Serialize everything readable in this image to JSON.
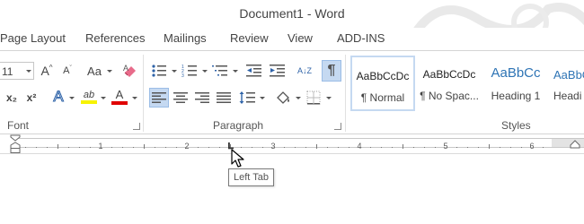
{
  "window": {
    "title": "Document1 - Word"
  },
  "tabs": [
    "Page Layout",
    "References",
    "Mailings",
    "Review",
    "View",
    "ADD-INS"
  ],
  "font_group": {
    "label": "Font",
    "size_value": "11",
    "grow_label": "A",
    "shrink_label": "A",
    "change_case_label": "Aa",
    "subscript_label": "x₂",
    "superscript_label": "x²",
    "text_effects_label": "A",
    "highlight_label": "ab",
    "font_color_label": "A",
    "highlight_color": "#f7f300",
    "font_color": "#e00000"
  },
  "paragraph_group": {
    "label": "Paragraph",
    "sort_label": "A↓Z",
    "pilcrow_label": "¶"
  },
  "styles_group": {
    "label": "Styles",
    "items": [
      {
        "sample": "AaBbCcDc",
        "name": "¶ Normal"
      },
      {
        "sample": "AaBbCcDc",
        "name": "¶ No Spac..."
      },
      {
        "sample": "AaBbCc",
        "name": "Heading 1"
      },
      {
        "sample": "AaBbC",
        "name": "Headi"
      }
    ],
    "heading_color": "#2e74b5"
  },
  "ruler": {
    "numbers": [
      "1",
      "2",
      "3",
      "4",
      "5",
      "6"
    ]
  },
  "tooltip": {
    "text": "Left Tab"
  }
}
